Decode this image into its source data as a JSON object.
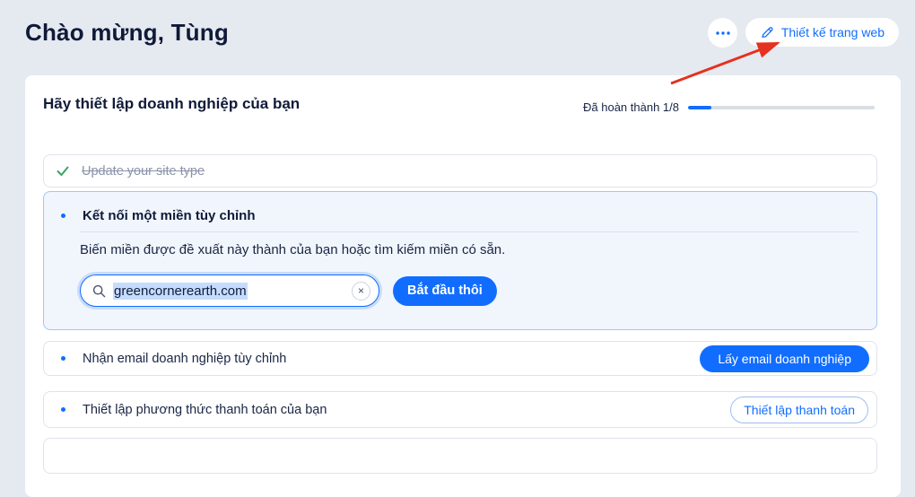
{
  "page": {
    "title": "Chào mừng, Tùng"
  },
  "header": {
    "design_button_label": "Thiết kế trang web",
    "icons": {
      "more": "ellipsis-icon",
      "design": "pencil-icon"
    }
  },
  "setup": {
    "title": "Hãy thiết lập doanh nghiệp của bạn",
    "progress": {
      "label": "Đã hoàn thành 1/8",
      "completed": 1,
      "total": 8,
      "percent": 12.5
    },
    "tasks": [
      {
        "label": "Update your site type",
        "status": "completed",
        "icon": "check-icon"
      },
      {
        "label": "Kết nối một miền tùy chỉnh",
        "status": "expanded",
        "description": "Biến miền được đề xuất này thành của bạn hoặc tìm kiếm miền có sẵn.",
        "domain_input": {
          "value": "greencornerearth.com",
          "icon": "search-icon",
          "clear_icon": "close-icon"
        },
        "action_label": "Bắt đầu thôi"
      },
      {
        "label": "Nhận email doanh nghiệp tùy chỉnh",
        "status": "pending",
        "action_label": "Lấy email doanh nghiệp"
      },
      {
        "label": "Thiết lập phương thức thanh toán của bạn",
        "status": "pending",
        "action_label": "Thiết lập thanh toán"
      }
    ]
  },
  "annotations": {
    "red_arrow": "points-to-design-site-button"
  },
  "colors": {
    "accent": "#116dff",
    "success_check": "#3aa563",
    "arrow_red": "#e5311f",
    "page_background": "#e5e9f0",
    "expanded_task_background": "#f1f6fd",
    "selection_highlight": "#c5dcfe"
  }
}
